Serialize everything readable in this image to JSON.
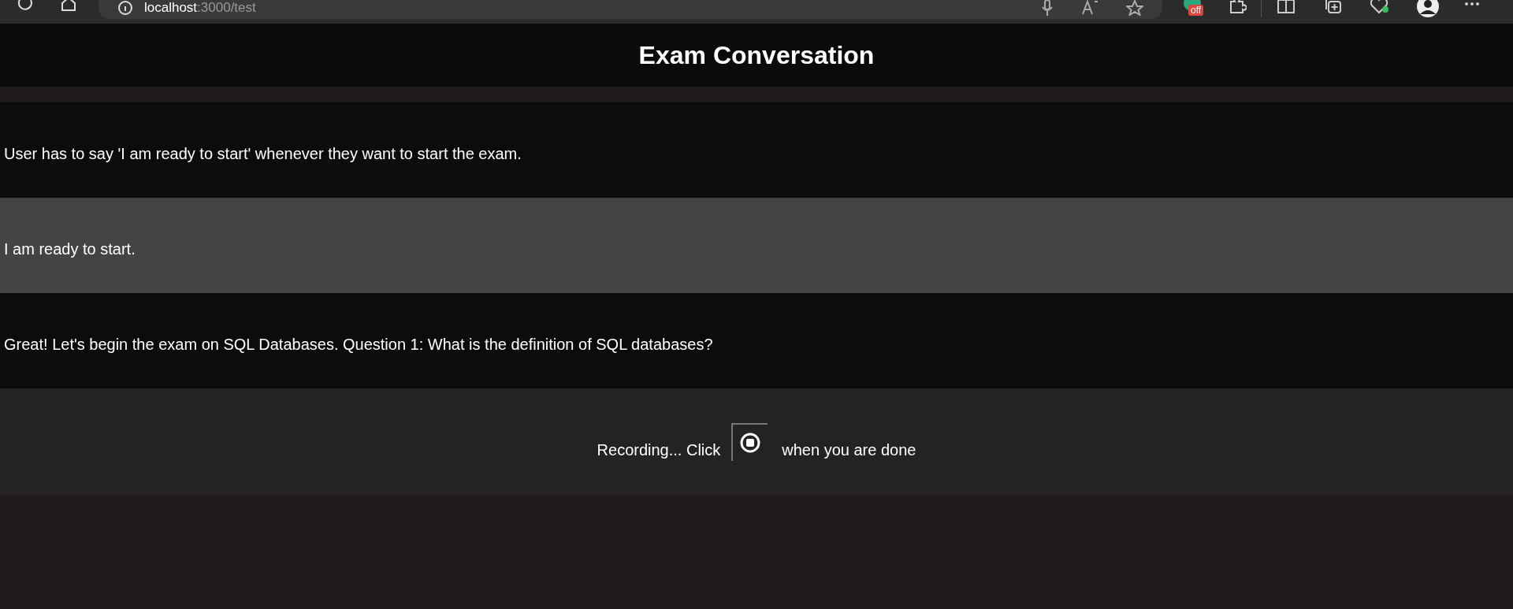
{
  "browser": {
    "url_host": "localhost",
    "url_rest": ":3000/test",
    "extension_badge": "off"
  },
  "header": {
    "title": "Exam Conversation"
  },
  "messages": [
    {
      "kind": "assistant",
      "text": "User has to say 'I am ready to start' whenever they want to start the exam."
    },
    {
      "kind": "user",
      "text": "I am ready to start."
    },
    {
      "kind": "assistant",
      "text": "Great! Let's begin the exam on SQL Databases. Question 1: What is the definition of SQL databases?"
    }
  ],
  "recorder": {
    "recording": true,
    "before": "Recording... Click",
    "after": "when you are done"
  }
}
